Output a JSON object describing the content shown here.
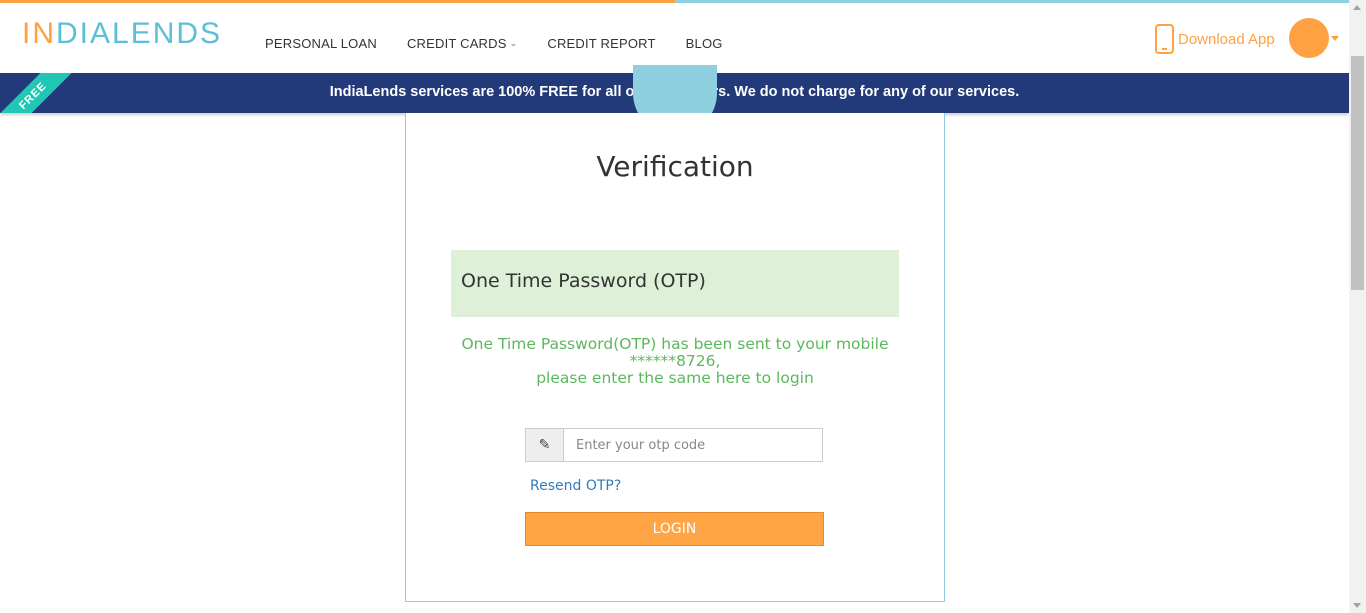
{
  "brand": {
    "logo_prefix": "IN",
    "logo_rest": "DIALENDS",
    "accent": "#ffa043",
    "primary": "#233a7a"
  },
  "nav": {
    "items": [
      {
        "label": "PERSONAL LOAN"
      },
      {
        "label": "CREDIT CARDS",
        "has_dropdown": true
      },
      {
        "label": "CREDIT REPORT"
      },
      {
        "label": "BLOG"
      }
    ]
  },
  "header": {
    "download_label": "Download App"
  },
  "banner": {
    "ribbon_label": "FREE",
    "text": "IndiaLends services are 100% FREE for all our customers. We do not charge for any of our services."
  },
  "verification": {
    "title": "Verification",
    "otp_heading": "One Time Password (OTP)",
    "message_line1": "One Time Password(OTP) has been sent to your mobile",
    "message_line2": "******8726,",
    "message_line3": "please enter the same here to login",
    "otp_placeholder": "Enter your otp code",
    "resend_label": "Resend OTP?",
    "login_label": "LOGIN"
  }
}
